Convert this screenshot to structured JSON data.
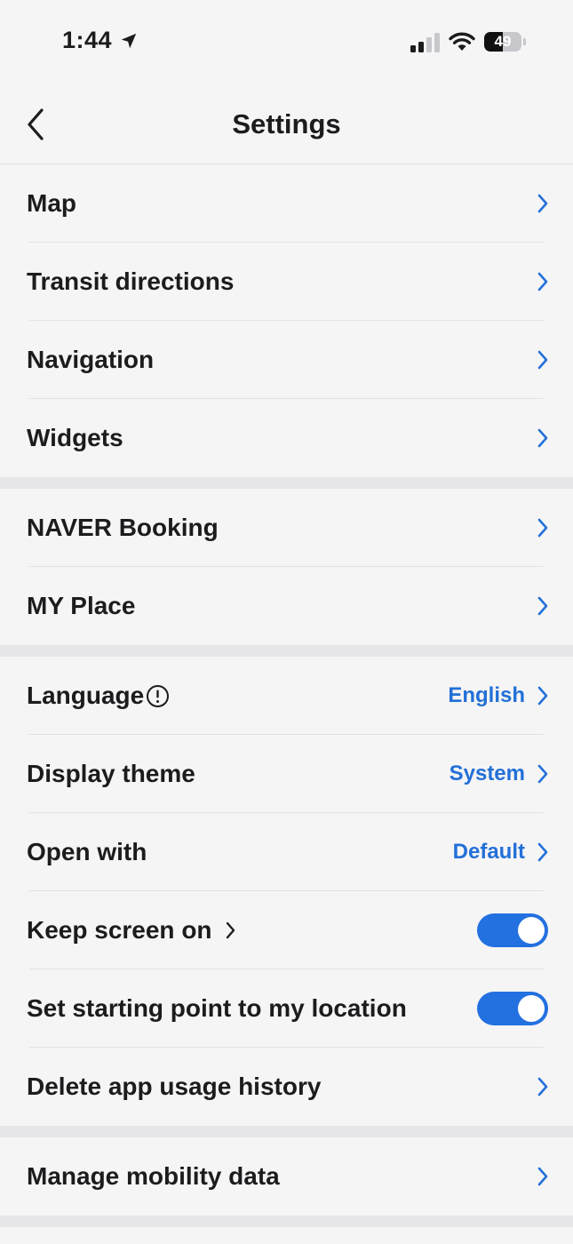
{
  "status": {
    "time": "1:44",
    "battery": "49",
    "battery_level": 0.49
  },
  "nav": {
    "title": "Settings"
  },
  "sections": [
    [
      {
        "label": "Map"
      },
      {
        "label": "Transit directions"
      },
      {
        "label": "Navigation"
      },
      {
        "label": "Widgets"
      }
    ],
    [
      {
        "label": "NAVER Booking"
      },
      {
        "label": "MY Place"
      }
    ],
    [
      {
        "label": "Language",
        "value": "English"
      },
      {
        "label": "Display theme",
        "value": "System"
      },
      {
        "label": "Open with",
        "value": "Default"
      },
      {
        "label": "Keep screen on",
        "toggle": true
      },
      {
        "label": "Set starting point to my location",
        "toggle": true
      },
      {
        "label": "Delete app usage history"
      }
    ],
    [
      {
        "label": "Manage mobility data"
      }
    ]
  ],
  "colors": {
    "accent": "#2370e0",
    "value_text": "#2370d8",
    "background": "#f5f5f6",
    "section_gap": "#e6e6e8"
  }
}
